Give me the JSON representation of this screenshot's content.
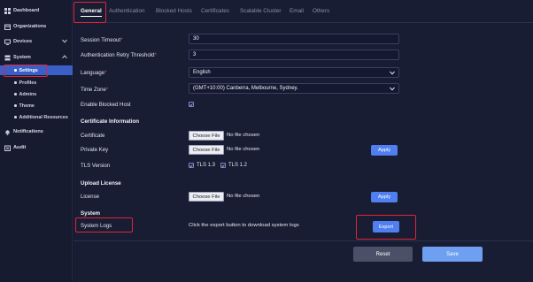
{
  "sidebar": {
    "items": [
      {
        "label": "Dashboard",
        "icon": "dashboard-icon"
      },
      {
        "label": "Organizations",
        "icon": "organizations-icon"
      },
      {
        "label": "Devices",
        "icon": "devices-icon"
      },
      {
        "label": "System",
        "icon": "system-icon"
      },
      {
        "label": "Notifications",
        "icon": "bell-icon"
      },
      {
        "label": "Audit",
        "icon": "audit-icon"
      }
    ],
    "system_sub": [
      {
        "label": "Settings"
      },
      {
        "label": "Profiles"
      },
      {
        "label": "Admins"
      },
      {
        "label": "Theme"
      },
      {
        "label": "Additional Resources"
      }
    ]
  },
  "tabs": [
    "General",
    "Authentication",
    "Blocked Hosts",
    "Certificates",
    "Scalable Cluster",
    "Email",
    "Others"
  ],
  "form": {
    "session_timeout": {
      "label": "Session Timeout",
      "value": "30"
    },
    "auth_retry": {
      "label": "Authentication Retry Threshold",
      "value": "3"
    },
    "language": {
      "label": "Language",
      "value": "English"
    },
    "time_zone": {
      "label": "Time Zone",
      "value": "(GMT+10:00) Canberra, Melbourne, Sydney."
    },
    "enable_blocked_host": {
      "label": "Enable Blocked Host",
      "checked": true
    },
    "cert_section": "Certificate Information",
    "certificate": {
      "label": "Certificate",
      "button": "Choose File",
      "status": "No file chosen"
    },
    "private_key": {
      "label": "Private Key",
      "button": "Choose File",
      "status": "No file chosen"
    },
    "tls": {
      "label": "TLS Version",
      "opt1": "TLS 1.3",
      "opt2": "TLS 1.2"
    },
    "apply_label": "Apply",
    "upload_section": "Upload License",
    "license": {
      "label": "License",
      "button": "Choose File",
      "status": "No file chosen"
    },
    "system_section": "System",
    "system_logs": {
      "label": "System Logs",
      "description": "Click the export button to download system logs",
      "button": "Export"
    }
  },
  "footer": {
    "reset": "Reset",
    "save": "Save"
  },
  "colors": {
    "accent": "#4f7ff0",
    "highlight": "#e0243a",
    "active_nav": "#3b5fc7"
  }
}
